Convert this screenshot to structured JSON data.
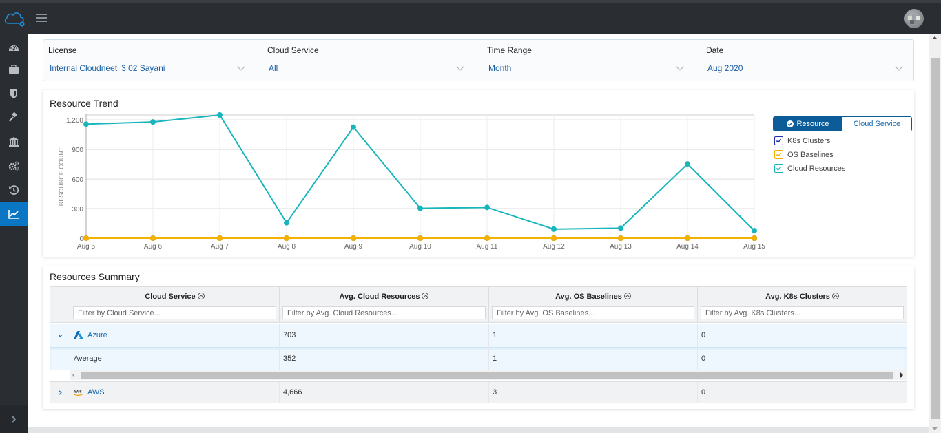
{
  "app": {
    "logo_icon": "cloud-gear-icon",
    "menu_icon": "hamburger-icon",
    "avatar_icon": "user-avatar"
  },
  "sidebar": {
    "items": [
      {
        "name": "dashboard",
        "icon": "speedometer-icon",
        "active": false
      },
      {
        "name": "briefcase",
        "icon": "briefcase-icon",
        "active": false
      },
      {
        "name": "security",
        "icon": "shield-icon",
        "active": false
      },
      {
        "name": "remediation",
        "icon": "gavel-icon",
        "active": false
      },
      {
        "name": "compliance",
        "icon": "bank-icon",
        "active": false
      },
      {
        "name": "settings",
        "icon": "gears-icon",
        "active": false
      },
      {
        "name": "history",
        "icon": "history-icon",
        "active": false
      },
      {
        "name": "trends",
        "icon": "line-chart-icon",
        "active": true
      }
    ],
    "expand_icon": "chevron-right-icon"
  },
  "filters": {
    "license": {
      "label": "License",
      "value": "Internal Cloudneeti 3.02 Sayani"
    },
    "cloud_service": {
      "label": "Cloud Service",
      "value": "All"
    },
    "time_range": {
      "label": "Time Range",
      "value": "Month"
    },
    "date": {
      "label": "Date",
      "value": "Aug 2020"
    }
  },
  "trend": {
    "title": "Resource Trend",
    "toggle": {
      "resource": "Resource",
      "cloud_service": "Cloud Service",
      "selected": "Resource"
    },
    "legend": [
      {
        "label": "K8s Clusters",
        "color": "#1f2fb0",
        "checked": true
      },
      {
        "label": "OS Baselines",
        "color": "#f5b100",
        "checked": true
      },
      {
        "label": "Cloud Resources",
        "color": "#19b5bd",
        "checked": true
      }
    ]
  },
  "chart_data": {
    "type": "line",
    "title": "Resource Trend",
    "xlabel": "",
    "ylabel": "RESOURCE COUNT",
    "x": [
      "Aug 5",
      "Aug 6",
      "Aug 7",
      "Aug 8",
      "Aug 9",
      "Aug 10",
      "Aug 11",
      "Aug 12",
      "Aug 13",
      "Aug 14",
      "Aug 15"
    ],
    "y_ticks": [
      0,
      300,
      600,
      900,
      1200
    ],
    "y_tick_labels": [
      "0",
      "300",
      "600",
      "900",
      "1,200"
    ],
    "ylim": [
      0,
      1250
    ],
    "grid": true,
    "legend_position": "right",
    "series": [
      {
        "name": "Cloud Resources",
        "color": "#19b5bd",
        "values": [
          1157,
          1179,
          1250,
          156,
          1127,
          303,
          312,
          92,
          102,
          753,
          76
        ]
      },
      {
        "name": "OS Baselines",
        "color": "#f5b100",
        "values": [
          0,
          0,
          0,
          0,
          0,
          0,
          0,
          0,
          0,
          0,
          0
        ]
      },
      {
        "name": "K8s Clusters",
        "color": "#1f2fb0",
        "values": [
          0,
          0,
          0,
          0,
          0,
          0,
          0,
          0,
          0,
          0,
          0
        ]
      }
    ]
  },
  "summary": {
    "title": "Resources Summary",
    "columns": [
      {
        "header": "Cloud Service",
        "filter_placeholder": "Filter by Cloud Service..."
      },
      {
        "header": "Avg. Cloud Resources",
        "filter_placeholder": "Filter by Avg. Cloud Resources..."
      },
      {
        "header": "Avg. OS Baselines",
        "filter_placeholder": "Filter by Avg. OS Baselines..."
      },
      {
        "header": "Avg. K8s Clusters",
        "filter_placeholder": "Filter by Avg. K8s Clusters..."
      }
    ],
    "rows": [
      {
        "service": "Azure",
        "icon": "azure-logo-icon",
        "expanded": true,
        "cloud_resources": "703",
        "os_baselines": "1",
        "k8s_clusters": "0",
        "detail": {
          "label": "Average",
          "cloud_resources": "352",
          "os_baselines": "1",
          "k8s_clusters": "0"
        }
      },
      {
        "service": "AWS",
        "icon": "aws-logo-icon",
        "expanded": false,
        "cloud_resources": "4,666",
        "os_baselines": "3",
        "k8s_clusters": "0"
      }
    ]
  }
}
